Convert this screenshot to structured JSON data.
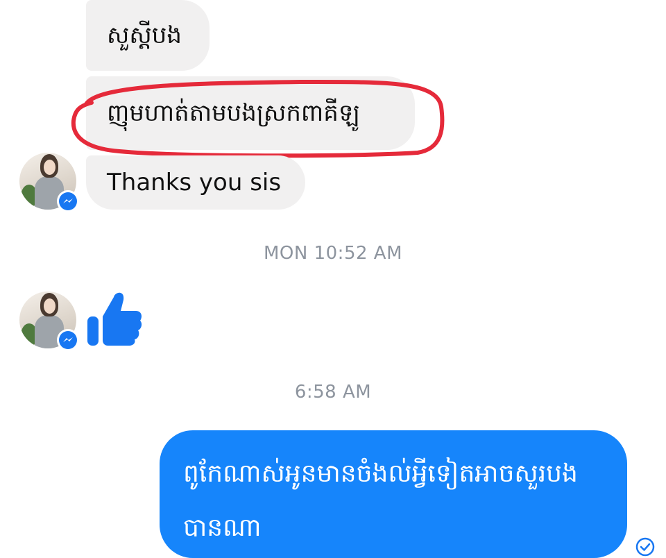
{
  "conversation": {
    "messages_in": [
      {
        "text": "សួស្តីបង"
      },
      {
        "text": "ញុមហាត់តាមបងស្រកពាគីឡូ"
      },
      {
        "text": "Thanks you sis"
      }
    ],
    "timestamp_1": "MON 10:52 AM",
    "reaction": "thumbs-up",
    "timestamp_2": "6:58 AM",
    "message_out": {
      "line1": "ពូកែណាស់អូនមានចំងល់អ្វីទៀតអាចសួរបង",
      "line2": "បានណា"
    },
    "status": "seen"
  },
  "colors": {
    "incoming_bubble": "#f1f0f0",
    "outgoing_bubble": "#1685fb",
    "like_blue": "#1877f2",
    "timestamp_gray": "#8d949e",
    "annotation_red": "#e52a3a"
  }
}
